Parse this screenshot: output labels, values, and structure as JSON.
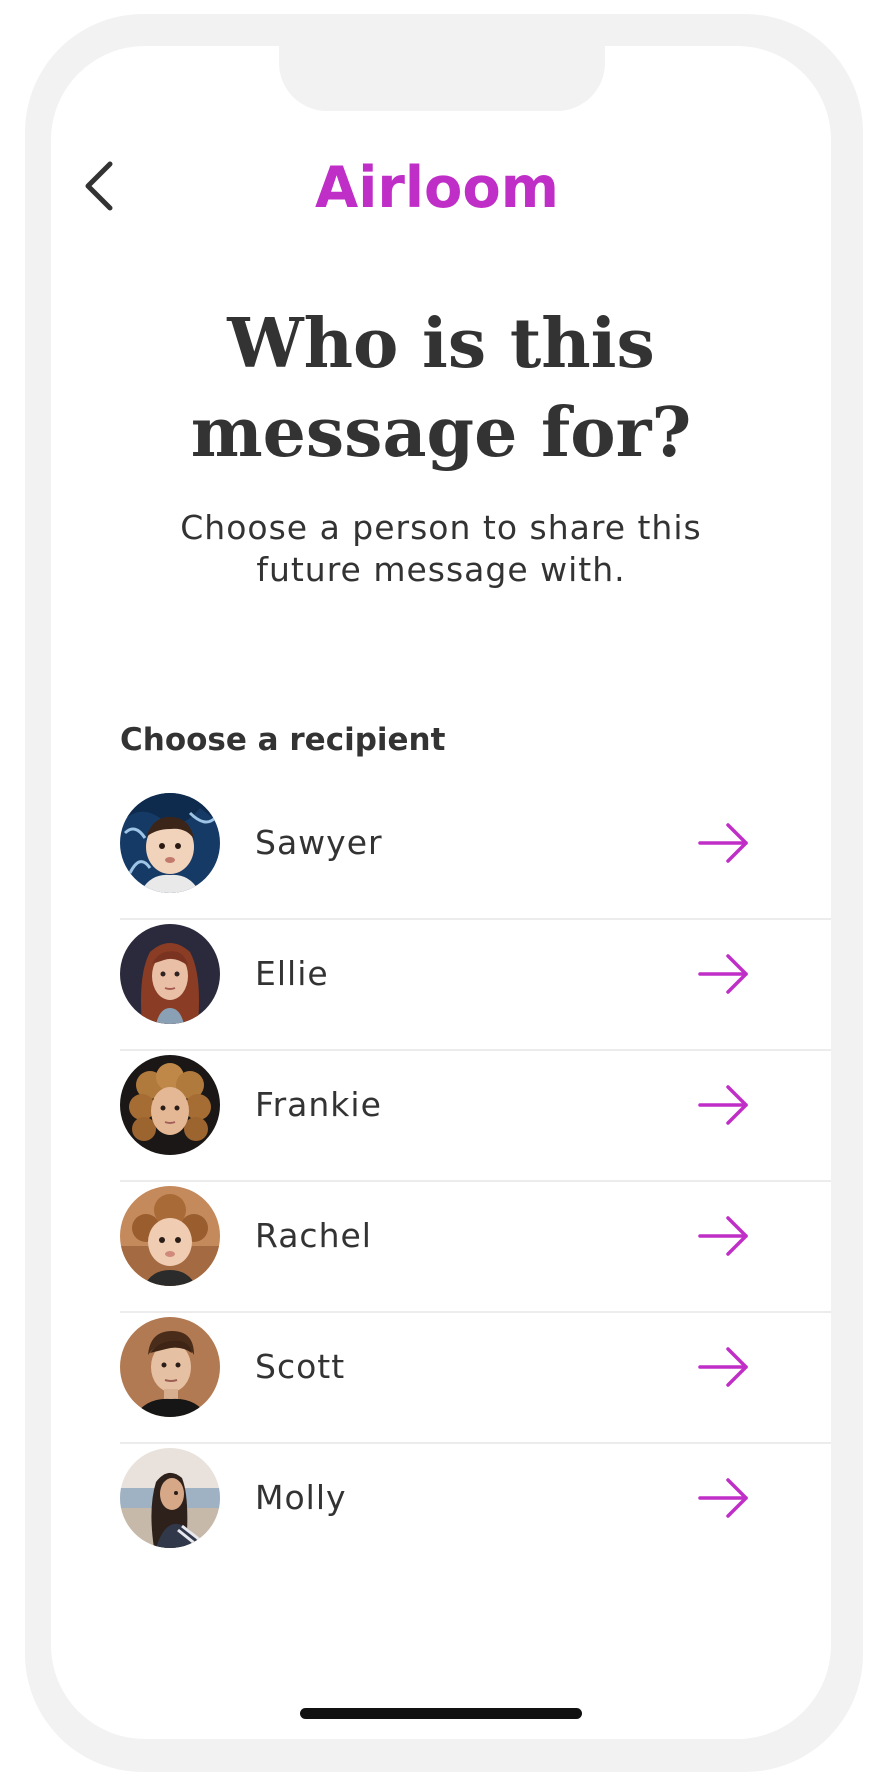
{
  "header": {
    "back_icon": "chevron-left-icon",
    "logo_text": "Airloom",
    "logo_color": "#c02ec8"
  },
  "main": {
    "title_lines": [
      "Who is this",
      "message for?"
    ],
    "subtitle_lines": [
      "Choose a person to share this",
      "future message with."
    ],
    "section_label": "Choose a recipient"
  },
  "recipients": [
    {
      "name": "Sawyer",
      "avatar": "baby-photo-avatar",
      "arrow_icon": "arrow-right-icon"
    },
    {
      "name": "Ellie",
      "avatar": "girl-red-hair-photo-avatar",
      "arrow_icon": "arrow-right-icon"
    },
    {
      "name": "Frankie",
      "avatar": "child-curly-hair-photo-avatar",
      "arrow_icon": "arrow-right-icon"
    },
    {
      "name": "Rachel",
      "avatar": "toddler-photo-avatar",
      "arrow_icon": "arrow-right-icon"
    },
    {
      "name": "Scott",
      "avatar": "young-man-photo-avatar",
      "arrow_icon": "arrow-right-icon"
    },
    {
      "name": "Molly",
      "avatar": "young-woman-beach-photo-avatar",
      "arrow_icon": "arrow-right-icon"
    }
  ],
  "colors": {
    "accent": "#c02ec8",
    "text": "#333333",
    "frame": "#f2f2f2",
    "divider": "#ececec"
  }
}
